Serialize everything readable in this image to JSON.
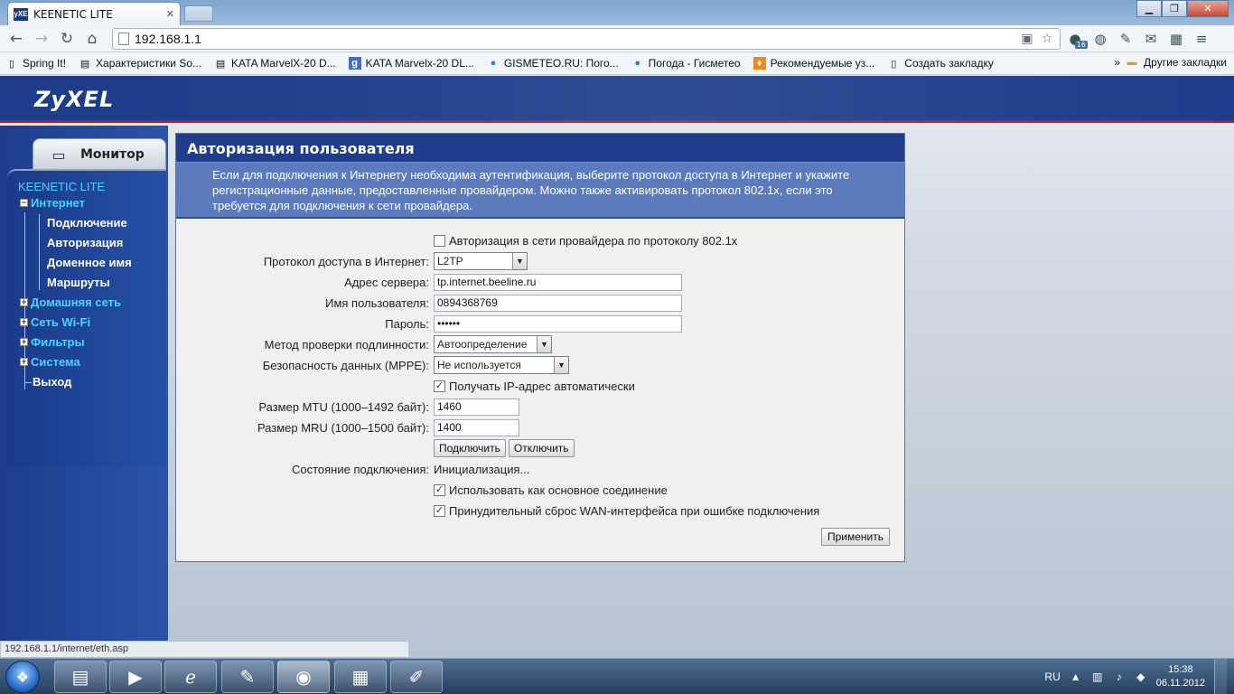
{
  "browser": {
    "tab_title": "KEENETIC LITE",
    "tab_favicon": "ZyXEL",
    "url": "192.168.1.1",
    "bookmarks": [
      {
        "label": "Spring It!",
        "icon": "page-icon"
      },
      {
        "label": "Характеристики So...",
        "icon": "bookmark-icon"
      },
      {
        "label": "KATA MarvelX-20 D...",
        "icon": "bookmark-icon"
      },
      {
        "label": "KATA Marvelx-20 DL...",
        "icon": "google-icon"
      },
      {
        "label": "GISMETEO.RU: Пого...",
        "icon": "drop-icon"
      },
      {
        "label": "Погода - Гисметео",
        "icon": "drop-icon"
      },
      {
        "label": "Рекомендуемые уз...",
        "icon": "flame-icon"
      },
      {
        "label": "Создать закладку",
        "icon": "page-icon"
      }
    ],
    "other_bookmarks": "Другие закладки",
    "extension_badge": "16",
    "status_url": "192.168.1.1/internet/eth.asp"
  },
  "router": {
    "logo": "ZyXEL",
    "monitor_tab": "Монитор",
    "device_name": "KEENETIC LITE",
    "nav": {
      "internet": "Интернет",
      "internet_sub": [
        "Подключение",
        "Авторизация",
        "Доменное имя",
        "Маршруты"
      ],
      "home_network": "Домашняя сеть",
      "wifi": "Сеть Wi-Fi",
      "filters": "Фильтры",
      "system": "Система",
      "exit": "Выход"
    },
    "expand_open": "−",
    "expand_closed": "+"
  },
  "form": {
    "title": "Авторизация пользователя",
    "description": "Если для подключения к Интернету необходима аутентификация, выберите протокол доступа в Интернет и укажите регистрационные данные, предоставленные провайдером. Можно также активировать протокол 802.1x, если это требуется для подключения к сети провайдера.",
    "auth_8021x_label": "Авторизация в сети провайдера по протоколу 802.1x",
    "auth_8021x_checked": false,
    "protocol_label": "Протокол доступа в Интернет:",
    "protocol_value": "L2TP",
    "server_label": "Адрес сервера:",
    "server_value": "tp.internet.beeline.ru",
    "username_label": "Имя пользователя:",
    "username_value": "0894368769",
    "password_label": "Пароль:",
    "password_value": "••••••",
    "auth_method_label": "Метод проверки подлинности:",
    "auth_method_value": "Автоопределение",
    "mppe_label": "Безопасность данных (MPPE):",
    "mppe_value": "Не используется",
    "auto_ip_label": "Получать IP-адрес автоматически",
    "auto_ip_checked": true,
    "mtu_label": "Размер MTU (1000–1492 байт):",
    "mtu_value": "1460",
    "mru_label": "Размер MRU (1000–1500 байт):",
    "mru_value": "1400",
    "connect_button": "Подключить",
    "disconnect_button": "Отключить",
    "status_label": "Состояние подключения:",
    "status_value": "Инициализация...",
    "primary_conn_label": "Использовать как основное соединение",
    "primary_conn_checked": true,
    "wan_reset_label": "Принудительный сброс WAN-интерфейса при ошибке подключения",
    "wan_reset_checked": true,
    "apply_button": "Применить",
    "check_mark": "✓"
  },
  "taskbar": {
    "lang": "RU",
    "time": "15:38",
    "date": "06.11.2012"
  }
}
